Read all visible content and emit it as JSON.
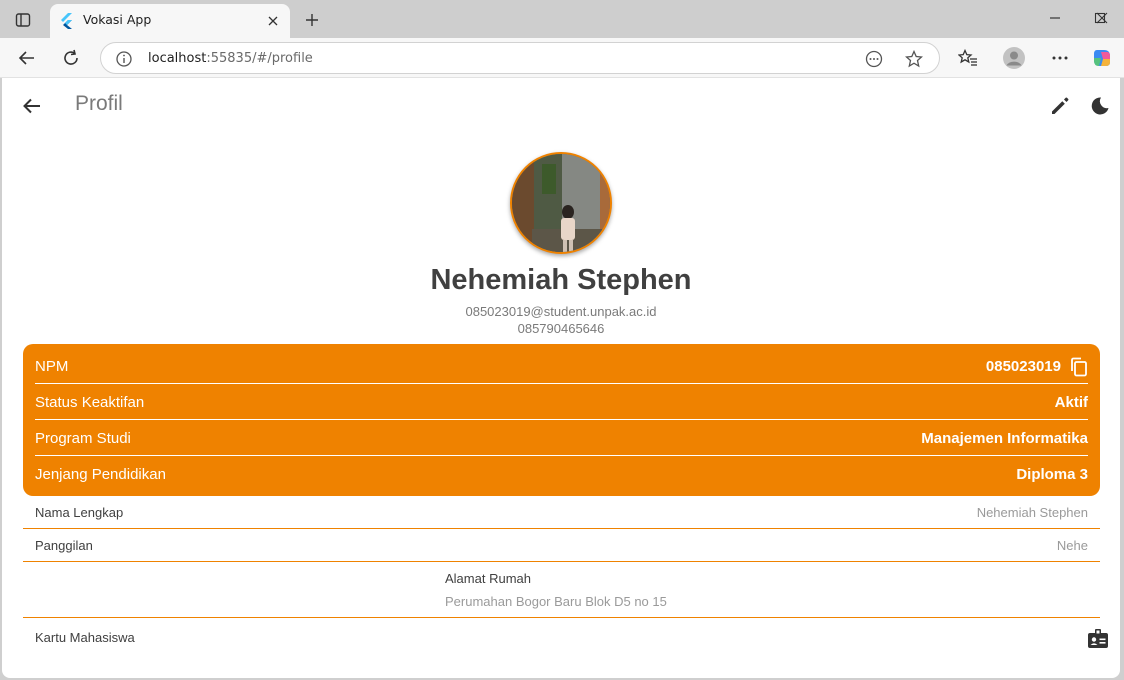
{
  "browser": {
    "tab_title": "Vokasi App",
    "url_host": "localhost",
    "url_path": ":55835/#/profile"
  },
  "appbar": {
    "title": "Profil"
  },
  "profile": {
    "name": "Nehemiah Stephen",
    "email": "085023019@student.unpak.ac.id",
    "phone": "085790465646"
  },
  "academic": [
    {
      "label": "NPM",
      "value": "085023019"
    },
    {
      "label": "Status Keaktifan",
      "value": "Aktif"
    },
    {
      "label": "Program Studi",
      "value": "Manajemen Informatika"
    },
    {
      "label": "Jenjang Pendidikan",
      "value": "Diploma 3"
    }
  ],
  "details": {
    "full_name_label": "Nama Lengkap",
    "full_name_value": "Nehemiah Stephen",
    "nickname_label": "Panggilan",
    "nickname_value": "Nehe",
    "address_label": "Alamat Rumah",
    "address_value": "Perumahan Bogor Baru Blok D5 no 15",
    "student_card_label": "Kartu Mahasiswa"
  },
  "colors": {
    "accent": "#ef8200",
    "text_dark": "#404040",
    "text_muted": "#9a9a9a"
  }
}
